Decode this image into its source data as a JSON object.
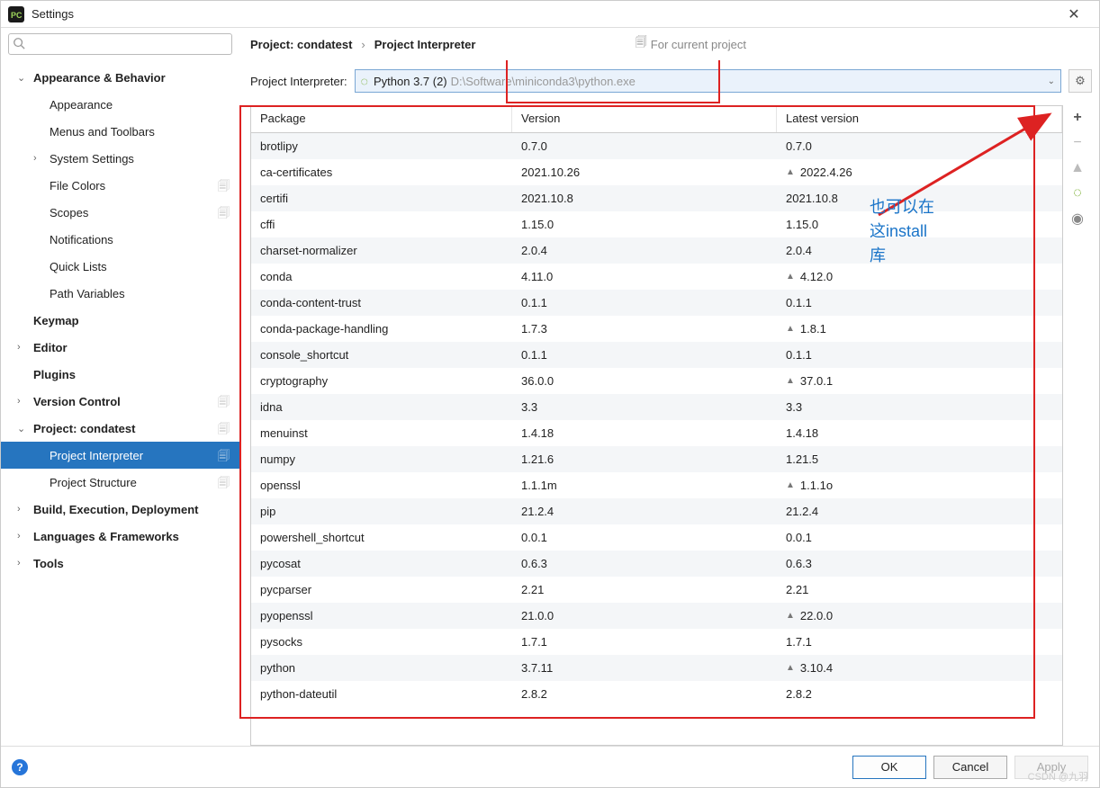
{
  "title": "Settings",
  "search_placeholder": "",
  "breadcrumbs": {
    "project": "Project: condatest",
    "page": "Project Interpreter",
    "hint": "For current project"
  },
  "interpreter": {
    "label": "Project Interpreter:",
    "name": "Python 3.7 (2)",
    "path": "D:\\Software\\miniconda3\\python.exe"
  },
  "sidebar": [
    {
      "label": "Appearance & Behavior",
      "bold": true,
      "chev": "v",
      "lvl": 1
    },
    {
      "label": "Appearance",
      "lvl": 2
    },
    {
      "label": "Menus and Toolbars",
      "lvl": 2
    },
    {
      "label": "System Settings",
      "lvl": 2,
      "chev": ">"
    },
    {
      "label": "File Colors",
      "lvl": 2,
      "badge": true
    },
    {
      "label": "Scopes",
      "lvl": 2,
      "badge": true
    },
    {
      "label": "Notifications",
      "lvl": 2
    },
    {
      "label": "Quick Lists",
      "lvl": 2
    },
    {
      "label": "Path Variables",
      "lvl": 2
    },
    {
      "label": "Keymap",
      "bold": true,
      "lvl": 1,
      "nochev": true
    },
    {
      "label": "Editor",
      "bold": true,
      "chev": ">",
      "lvl": 1
    },
    {
      "label": "Plugins",
      "bold": true,
      "lvl": 1,
      "nochev": true
    },
    {
      "label": "Version Control",
      "bold": true,
      "chev": ">",
      "lvl": 1,
      "badge": true
    },
    {
      "label": "Project: condatest",
      "bold": true,
      "chev": "v",
      "lvl": 1,
      "badge": true
    },
    {
      "label": "Project Interpreter",
      "lvl": 2,
      "sel": true,
      "badge": true
    },
    {
      "label": "Project Structure",
      "lvl": 2,
      "badge": true
    },
    {
      "label": "Build, Execution, Deployment",
      "bold": true,
      "chev": ">",
      "lvl": 1
    },
    {
      "label": "Languages & Frameworks",
      "bold": true,
      "chev": ">",
      "lvl": 1
    },
    {
      "label": "Tools",
      "bold": true,
      "chev": ">",
      "lvl": 1
    }
  ],
  "table": {
    "headers": {
      "pkg": "Package",
      "ver": "Version",
      "lat": "Latest version"
    },
    "rows": [
      {
        "pkg": "brotlipy",
        "ver": "0.7.0",
        "lat": "0.7.0"
      },
      {
        "pkg": "ca-certificates",
        "ver": "2021.10.26",
        "lat": "2022.4.26",
        "up": true
      },
      {
        "pkg": "certifi",
        "ver": "2021.10.8",
        "lat": "2021.10.8"
      },
      {
        "pkg": "cffi",
        "ver": "1.15.0",
        "lat": "1.15.0"
      },
      {
        "pkg": "charset-normalizer",
        "ver": "2.0.4",
        "lat": "2.0.4"
      },
      {
        "pkg": "conda",
        "ver": "4.11.0",
        "lat": "4.12.0",
        "up": true
      },
      {
        "pkg": "conda-content-trust",
        "ver": "0.1.1",
        "lat": "0.1.1"
      },
      {
        "pkg": "conda-package-handling",
        "ver": "1.7.3",
        "lat": "1.8.1",
        "up": true
      },
      {
        "pkg": "console_shortcut",
        "ver": "0.1.1",
        "lat": "0.1.1"
      },
      {
        "pkg": "cryptography",
        "ver": "36.0.0",
        "lat": "37.0.1",
        "up": true
      },
      {
        "pkg": "idna",
        "ver": "3.3",
        "lat": "3.3"
      },
      {
        "pkg": "menuinst",
        "ver": "1.4.18",
        "lat": "1.4.18"
      },
      {
        "pkg": "numpy",
        "ver": "1.21.6",
        "lat": "1.21.5"
      },
      {
        "pkg": "openssl",
        "ver": "1.1.1m",
        "lat": "1.1.1o",
        "up": true
      },
      {
        "pkg": "pip",
        "ver": "21.2.4",
        "lat": "21.2.4"
      },
      {
        "pkg": "powershell_shortcut",
        "ver": "0.0.1",
        "lat": "0.0.1"
      },
      {
        "pkg": "pycosat",
        "ver": "0.6.3",
        "lat": "0.6.3"
      },
      {
        "pkg": "pycparser",
        "ver": "2.21",
        "lat": "2.21"
      },
      {
        "pkg": "pyopenssl",
        "ver": "21.0.0",
        "lat": "22.0.0",
        "up": true
      },
      {
        "pkg": "pysocks",
        "ver": "1.7.1",
        "lat": "1.7.1"
      },
      {
        "pkg": "python",
        "ver": "3.7.11",
        "lat": "3.10.4",
        "up": true
      },
      {
        "pkg": "python-dateutil",
        "ver": "2.8.2",
        "lat": "2.8.2"
      }
    ]
  },
  "annotation": {
    "line1": "也可以在",
    "line2": "这install",
    "line3": "库"
  },
  "buttons": {
    "ok": "OK",
    "cancel": "Cancel",
    "apply": "Apply"
  },
  "watermark": "CSDN @九羽"
}
